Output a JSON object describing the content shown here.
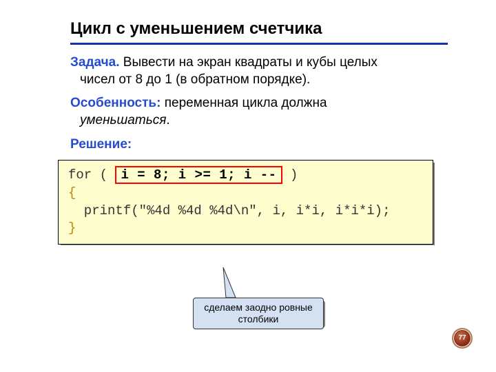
{
  "title": "Цикл с уменьшением счетчика",
  "task": {
    "label": "Задача.",
    "text_line1": " Вывести на экран квадраты и кубы целых",
    "text_line2": "чисел от 8 до 1 (в обратном порядке)."
  },
  "feature": {
    "label": "Особенность:",
    "text_line1": " переменная цикла должна",
    "text_line2": "уменьшаться"
  },
  "solution_label": "Решение:",
  "code": {
    "for_kw": "for",
    "open_paren": " ( ",
    "highlight": "i = 8; i >= 1; i --",
    "close_paren": " )",
    "brace_open": "{",
    "printf_call": "  printf(\"%4d %4d %4d\\n\", i, i*i, i*i*i);",
    "brace_close": "}"
  },
  "callout": {
    "line1": "сделаем заодно ровные",
    "line2": "столбики"
  },
  "page_number": "77"
}
